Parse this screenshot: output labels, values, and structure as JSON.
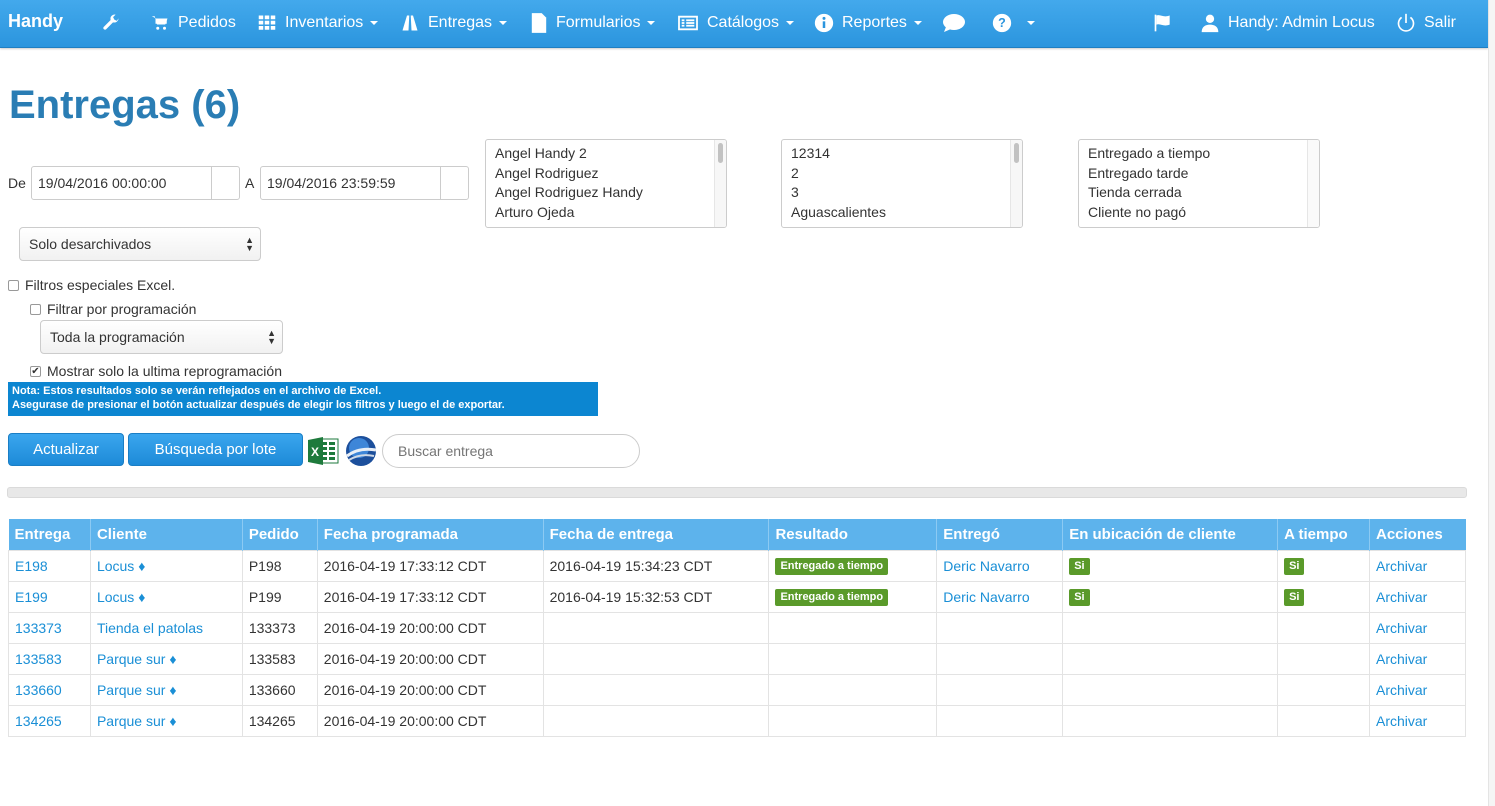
{
  "nav": {
    "brand": "Handy",
    "items": [
      {
        "label": "Pedidos"
      },
      {
        "label": "Inventarios"
      },
      {
        "label": "Entregas"
      },
      {
        "label": "Formularios"
      },
      {
        "label": "Catálogos"
      },
      {
        "label": "Reportes"
      }
    ],
    "user": "Handy: Admin Locus",
    "logout": "Salir"
  },
  "page": {
    "title": "Entregas (6)"
  },
  "filters": {
    "from_label": "De",
    "from_value": "19/04/2016 00:00:00",
    "to_label": "A",
    "to_value": "19/04/2016 23:59:59",
    "archive_select": "Solo desarchivados",
    "users_list": [
      "Angel Handy 2",
      "Angel Rodriguez",
      "Angel Rodriguez Handy",
      "Arturo Ojeda"
    ],
    "clients_list": [
      "12314",
      "2",
      "3",
      "Aguascalientes"
    ],
    "results_list": [
      "Entregado a tiempo",
      "Entregado tarde",
      "Tienda cerrada",
      "Cliente no pagó"
    ],
    "excel_special": "Filtros especiales Excel.",
    "filter_schedule": "Filtrar por programación",
    "schedule_select": "Toda la programación",
    "last_reschedule": "Mostrar solo la ultima reprogramación",
    "note_line1": "Nota: Estos resultados solo se verán reflejados en el archivo de Excel.",
    "note_line2": "Asegurase de presionar el botón actualizar después de elegir los filtros y luego el de exportar."
  },
  "actions": {
    "update": "Actualizar",
    "batch_search": "Búsqueda por lote",
    "search_placeholder": "Buscar entrega"
  },
  "table": {
    "headers": [
      "Entrega",
      "Cliente",
      "Pedido",
      "Fecha programada",
      "Fecha de entrega",
      "Resultado",
      "Entregó",
      "En ubicación de cliente",
      "A tiempo",
      "Acciones"
    ],
    "rows": [
      {
        "id": "E198",
        "client": "Locus ♦",
        "order": "P198",
        "scheduled": "2016-04-19 17:33:12 CDT",
        "delivered": "2016-04-19 15:34:23 CDT",
        "result": "Entregado a tiempo",
        "by": "Deric Navarro",
        "at_location": "Si",
        "on_time": "Si",
        "action": "Archivar"
      },
      {
        "id": "E199",
        "client": "Locus ♦",
        "order": "P199",
        "scheduled": "2016-04-19 17:33:12 CDT",
        "delivered": "2016-04-19 15:32:53 CDT",
        "result": "Entregado a tiempo",
        "by": "Deric Navarro",
        "at_location": "Si",
        "on_time": "Si",
        "action": "Archivar"
      },
      {
        "id": "133373",
        "client": "Tienda el patolas",
        "order": "133373",
        "scheduled": "2016-04-19 20:00:00 CDT",
        "delivered": "",
        "result": "",
        "by": "",
        "at_location": "",
        "on_time": "",
        "action": "Archivar"
      },
      {
        "id": "133583",
        "client": "Parque sur ♦",
        "order": "133583",
        "scheduled": "2016-04-19 20:00:00 CDT",
        "delivered": "",
        "result": "",
        "by": "",
        "at_location": "",
        "on_time": "",
        "action": "Archivar"
      },
      {
        "id": "133660",
        "client": "Parque sur ♦",
        "order": "133660",
        "scheduled": "2016-04-19 20:00:00 CDT",
        "delivered": "",
        "result": "",
        "by": "",
        "at_location": "",
        "on_time": "",
        "action": "Archivar"
      },
      {
        "id": "134265",
        "client": "Parque sur ♦",
        "order": "134265",
        "scheduled": "2016-04-19 20:00:00 CDT",
        "delivered": "",
        "result": "",
        "by": "",
        "at_location": "",
        "on_time": "",
        "action": "Archivar"
      }
    ]
  },
  "colors": {
    "navbar": "#2b95de",
    "title": "#2a7db4",
    "badge": "#5a9a2a",
    "link": "#1a8fd6",
    "table_header": "#5db3ec",
    "note_bg": "#0c86d1"
  }
}
